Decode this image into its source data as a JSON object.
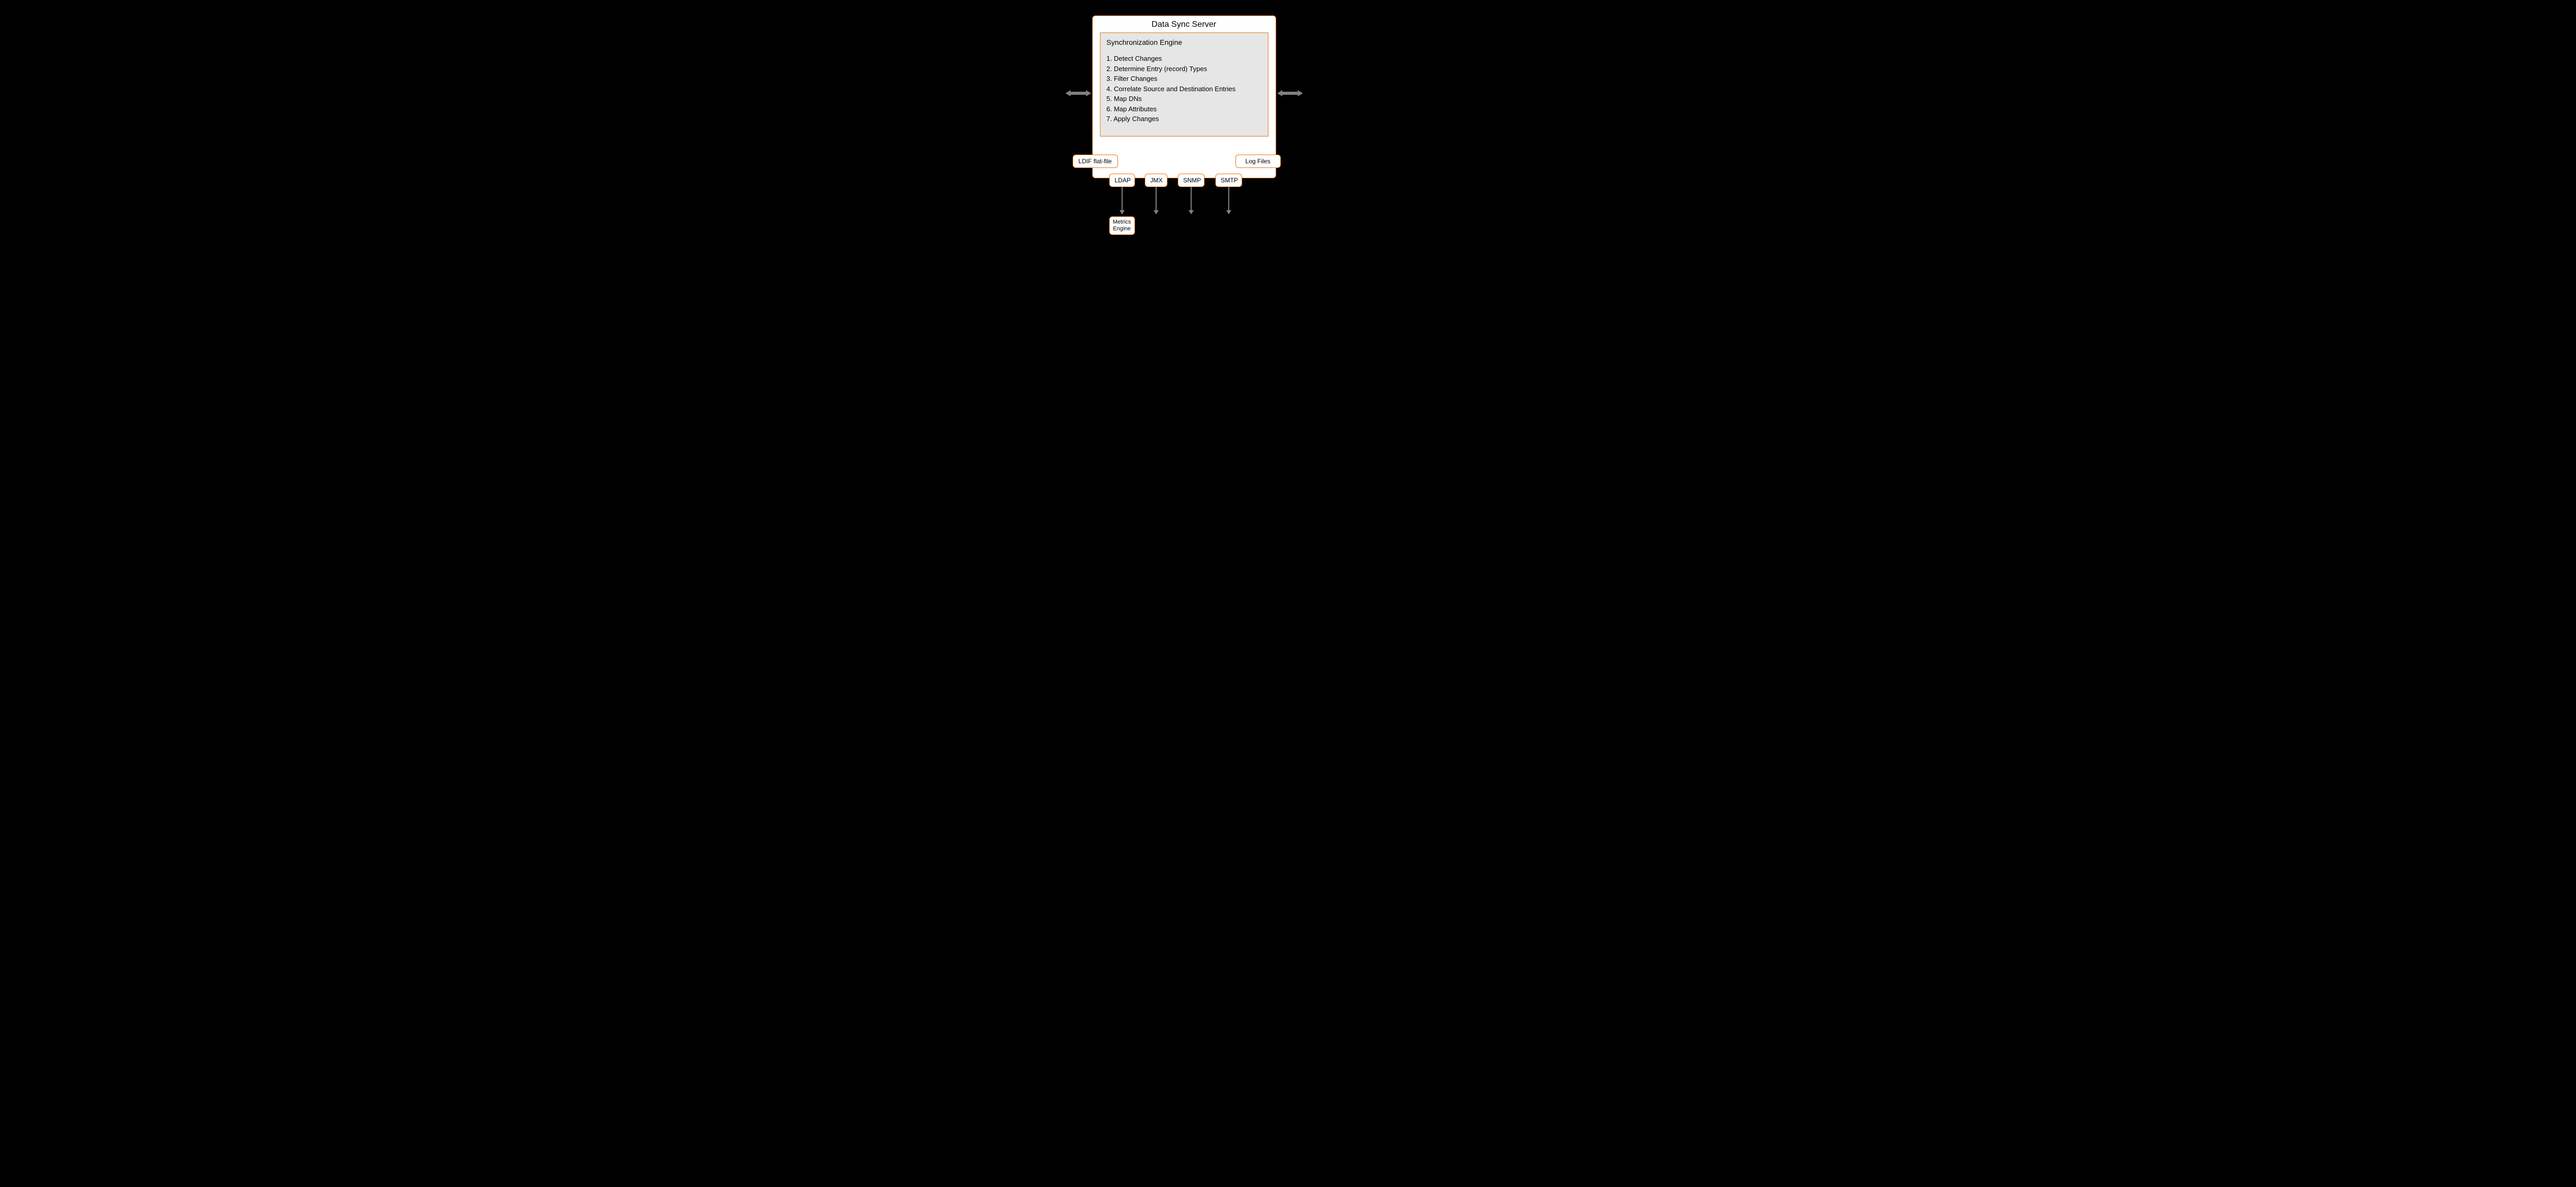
{
  "server": {
    "title": "Data Sync Server",
    "engine_title": "Synchronization Engine",
    "steps": [
      "1. Detect Changes",
      "2. Determine Entry (record) Types",
      "3. Filter Changes",
      "4. Correlate Source and Destination Entries",
      "5. Map DNs",
      "6. Map Attributes",
      "7. Apply Changes"
    ]
  },
  "pills": {
    "ldif": "LDIF flat-file",
    "log": "Log Files",
    "ldap": "LDAP",
    "jmx": "JMX",
    "snmp": "SNMP",
    "smtp": "SMTP"
  },
  "metrics": {
    "line1": "Metrics",
    "line2": "Engine"
  }
}
